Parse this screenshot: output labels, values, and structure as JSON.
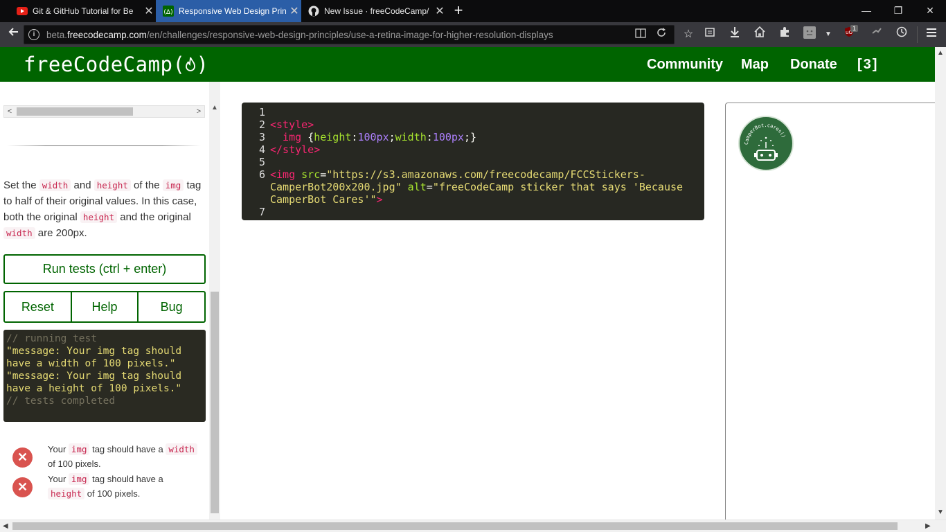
{
  "browser": {
    "tabs": [
      {
        "title": "Git & GitHub Tutorial for Be",
        "icon": "youtube-icon",
        "active": false
      },
      {
        "title": "Responsive Web Design Prin",
        "icon": "freecodecamp-icon",
        "active": true
      },
      {
        "title": "New Issue · freeCodeCamp/",
        "icon": "github-icon",
        "active": false
      }
    ],
    "url_host": "beta.freecodecamp.com",
    "url_path": "/en/challenges/responsive-web-design-principles/use-a-retina-image-for-higher-resolution-displays",
    "url_prefix": "beta.",
    "url_domain": "freecodecamp.com",
    "ublock_badge": "1"
  },
  "header": {
    "logo": "freeCodeCamp(🔥)",
    "logo_text": "freeCodeCamp(",
    "logo_close": ")",
    "nav": [
      "Community",
      "Map",
      "Donate",
      "[3]"
    ],
    "bg_color": "#006400"
  },
  "instructions": {
    "p1": "Set the ",
    "width": "width",
    "and": " and ",
    "height": "height",
    "of_the": " of the ",
    "img": "img",
    "p2": " tag to half of their original values. In this case, both the original ",
    "and_the": " and the original ",
    "are": " are 200px."
  },
  "buttons": {
    "run": "Run tests (ctrl + enter)",
    "reset": "Reset",
    "help": "Help",
    "bug": "Bug"
  },
  "output": {
    "line1": "// running test",
    "line2": "\"message: Your img tag should have a width of 100 pixels.\"",
    "line3": "\"message: Your img tag should have a height of 100 pixels.\"",
    "line4": "// tests completed"
  },
  "tests": [
    {
      "pre": "Your ",
      "code1": "img",
      "mid": " tag should have a ",
      "code2": "width",
      "post": " of 100 pixels."
    },
    {
      "pre": "Your ",
      "code1": "img",
      "mid": " tag should have a ",
      "code2": "height",
      "post": " of 100 pixels."
    }
  ],
  "editor": {
    "line_numbers": [
      "1",
      "2",
      "3",
      "4",
      "5",
      "6",
      "7"
    ],
    "style_open": "<style>",
    "img_sel": "  img ",
    "brace_open": "{",
    "prop1": "height",
    "val1": "100px",
    "prop2": "width",
    "val2": "100px",
    "brace_close": ";}",
    "style_close": "</style>",
    "img_tag_open": "<img",
    "src_attr": " src",
    "src_val": "\"https://s3.amazonaws.com/freecodecamp/FCCStickers-CamperBot200x200.jpg\"",
    "alt_attr": " alt",
    "alt_val": "\"freeCodeCamp sticker that says 'Because CamperBot Cares'\"",
    "tag_end": ">"
  },
  "preview": {
    "sticker_text": "CamperBot.cares()"
  }
}
